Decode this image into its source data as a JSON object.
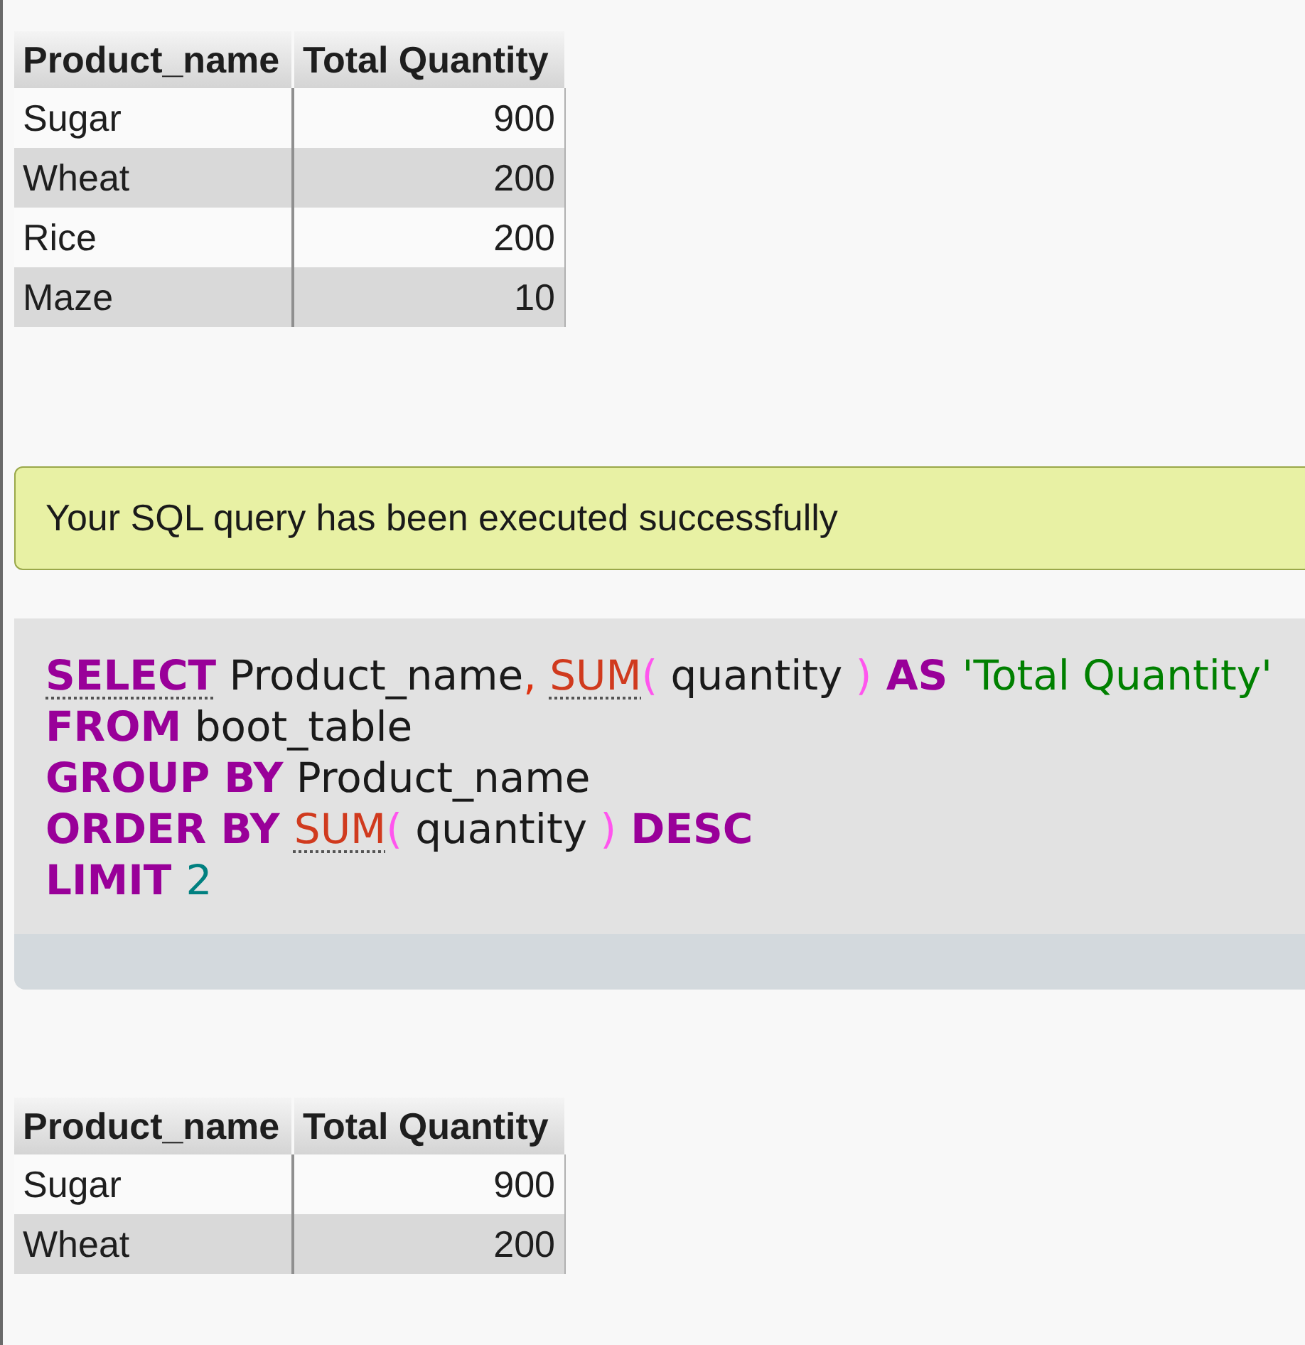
{
  "result_table_top": {
    "columns": [
      "Product_name",
      "Total Quantity"
    ],
    "rows": [
      [
        "Sugar",
        "900"
      ],
      [
        "Wheat",
        "200"
      ],
      [
        "Rice",
        "200"
      ],
      [
        "Maze",
        "10"
      ]
    ]
  },
  "success_message": {
    "text": "Your SQL query has been executed successfully"
  },
  "query": {
    "lines": [
      [
        {
          "text": "SELECT",
          "kind": "keyword",
          "link": true
        },
        {
          "text": " Product_name",
          "kind": "identifier"
        },
        {
          "text": ", ",
          "kind": "punct"
        },
        {
          "text": "SUM",
          "kind": "function",
          "link": true
        },
        {
          "text": "(",
          "kind": "paren"
        },
        {
          "text": " quantity ",
          "kind": "identifier"
        },
        {
          "text": ")",
          "kind": "paren"
        },
        {
          "text": " AS ",
          "kind": "keyword"
        },
        {
          "text": "'Total Quantity'",
          "kind": "string"
        }
      ],
      [
        {
          "text": "FROM",
          "kind": "keyword"
        },
        {
          "text": " boot_table",
          "kind": "identifier"
        }
      ],
      [
        {
          "text": "GROUP BY",
          "kind": "keyword"
        },
        {
          "text": " Product_name",
          "kind": "identifier"
        }
      ],
      [
        {
          "text": "ORDER BY ",
          "kind": "keyword"
        },
        {
          "text": "SUM",
          "kind": "function",
          "link": true
        },
        {
          "text": "(",
          "kind": "paren"
        },
        {
          "text": " quantity ",
          "kind": "identifier"
        },
        {
          "text": ")",
          "kind": "paren"
        },
        {
          "text": " DESC",
          "kind": "keyword"
        }
      ],
      [
        {
          "text": "LIMIT ",
          "kind": "keyword"
        },
        {
          "text": "2",
          "kind": "number"
        }
      ]
    ]
  },
  "result_table_bottom": {
    "columns": [
      "Product_name",
      "Total Quantity"
    ],
    "rows": [
      [
        "Sugar",
        "900"
      ],
      [
        "Wheat",
        "200"
      ]
    ]
  }
}
